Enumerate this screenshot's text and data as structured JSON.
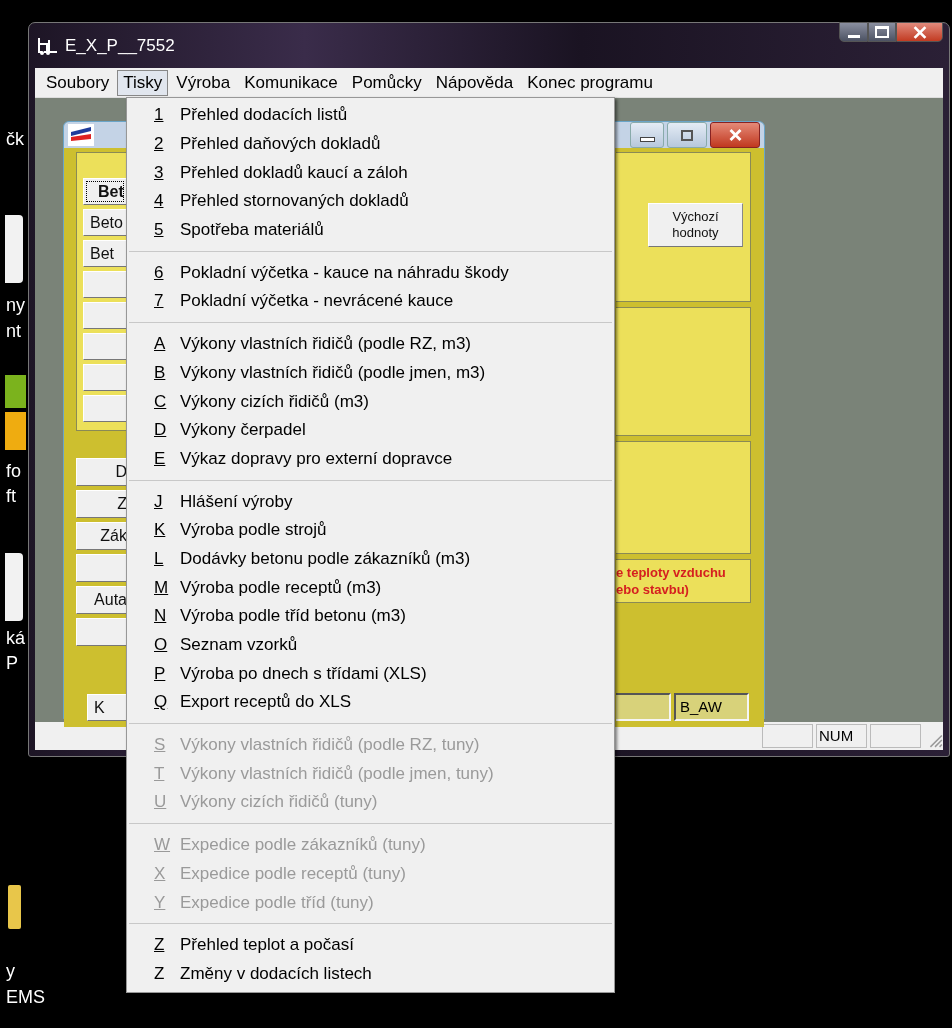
{
  "desktop_labels": [
    "čk",
    "ny",
    "nt",
    "fo",
    "ft",
    "ká",
    "P",
    "y",
    "EMS"
  ],
  "window": {
    "title": "E_X_P__7552"
  },
  "menu_bar": [
    {
      "label": "Soubory",
      "selected": false
    },
    {
      "label": "Tisky",
      "selected": true
    },
    {
      "label": "Výroba",
      "selected": false
    },
    {
      "label": "Komunikace",
      "selected": false
    },
    {
      "label": "Pomůcky",
      "selected": false
    },
    {
      "label": "Nápověda",
      "selected": false
    },
    {
      "label": "Konec programu",
      "selected": false
    }
  ],
  "child_window": {
    "frame_buttons": [
      {
        "label": "Bet",
        "focused": true
      },
      {
        "label": "Beto",
        "focused": false
      },
      {
        "label": "Bet",
        "focused": false
      },
      {
        "focused": false
      },
      {
        "focused": false
      },
      {
        "focused": false
      },
      {
        "focused": false
      },
      {
        "focused": false
      }
    ],
    "side_buttons": [
      {
        "kind": "labeled",
        "label": "D"
      },
      {
        "kind": "labeled",
        "label": "Z"
      },
      {
        "kind": "labeled",
        "label": "Zák"
      },
      {
        "kind": "blank"
      },
      {
        "kind": "labeled",
        "label": "Auta"
      },
      {
        "kind": "blank"
      }
    ],
    "bottom_button": "K",
    "defaults_button": "Výchozí hodnoty",
    "warning_lines": [
      "e teploty vzduchu",
      "ebo stavbu)"
    ],
    "status_fields": [
      {
        "kind": "blank"
      },
      {
        "kind": "labeled",
        "label": "B_AW"
      }
    ]
  },
  "status_bar": {
    "panels": [
      {
        "kind": "blank"
      },
      {
        "kind": "labeled",
        "label": "NUM"
      },
      {
        "kind": "blank"
      }
    ]
  },
  "dropdown": [
    {
      "kind": "item",
      "key": "1",
      "label": "Přehled dodacích listů",
      "disabled": false,
      "underlined": true
    },
    {
      "kind": "item",
      "key": "2",
      "label": "Přehled daňových dokladů",
      "disabled": false,
      "underlined": true
    },
    {
      "kind": "item",
      "key": "3",
      "label": "Přehled dokladů kaucí a záloh",
      "disabled": false,
      "underlined": true
    },
    {
      "kind": "item",
      "key": "4",
      "label": "Přehled stornovaných dokladů",
      "disabled": false,
      "underlined": true
    },
    {
      "kind": "item",
      "key": "5",
      "label": "Spotřeba materiálů",
      "disabled": false,
      "underlined": true
    },
    {
      "kind": "separator"
    },
    {
      "kind": "item",
      "key": "6",
      "label": "Pokladní výčetka - kauce na náhradu škody",
      "disabled": false,
      "underlined": true
    },
    {
      "kind": "item",
      "key": "7",
      "label": "Pokladní výčetka - nevrácené kauce",
      "disabled": false,
      "underlined": true
    },
    {
      "kind": "separator"
    },
    {
      "kind": "item",
      "key": "A",
      "label": "Výkony vlastních řidičů (podle RZ, m3)",
      "disabled": false,
      "underlined": true
    },
    {
      "kind": "item",
      "key": "B",
      "label": "Výkony vlastních řidičů (podle jmen, m3)",
      "disabled": false,
      "underlined": true
    },
    {
      "kind": "item",
      "key": "C",
      "label": "Výkony cizích řidičů (m3)",
      "disabled": false,
      "underlined": true
    },
    {
      "kind": "item",
      "key": "D",
      "label": "Výkony čerpadel",
      "disabled": false,
      "underlined": true
    },
    {
      "kind": "item",
      "key": "E",
      "label": "Výkaz dopravy pro externí dopravce",
      "disabled": false,
      "underlined": true
    },
    {
      "kind": "separator"
    },
    {
      "kind": "item",
      "key": "J",
      "label": "Hlášení výroby",
      "disabled": false,
      "underlined": true
    },
    {
      "kind": "item",
      "key": "K",
      "label": "Výroba podle strojů",
      "disabled": false,
      "underlined": true
    },
    {
      "kind": "item",
      "key": "L",
      "label": "Dodávky betonu podle zákazníků (m3)",
      "disabled": false,
      "underlined": true
    },
    {
      "kind": "item",
      "key": "M",
      "label": "Výroba podle receptů (m3)",
      "disabled": false,
      "underlined": true
    },
    {
      "kind": "item",
      "key": "N",
      "label": "Výroba podle tříd betonu (m3)",
      "disabled": false,
      "underlined": true
    },
    {
      "kind": "item",
      "key": "O",
      "label": "Seznam vzorků",
      "disabled": false,
      "underlined": true
    },
    {
      "kind": "item",
      "key": "P",
      "label": "Výroba po dnech s třídami (XLS)",
      "disabled": false,
      "underlined": true
    },
    {
      "kind": "item",
      "key": "Q",
      "label": "Export receptů do XLS",
      "disabled": false,
      "underlined": true
    },
    {
      "kind": "separator"
    },
    {
      "kind": "item",
      "key": "S",
      "label": "Výkony vlastních řidičů (podle RZ, tuny)",
      "disabled": true,
      "underlined": true
    },
    {
      "kind": "item",
      "key": "T",
      "label": "Výkony vlastních řidičů (podle jmen, tuny)",
      "disabled": true,
      "underlined": true
    },
    {
      "kind": "item",
      "key": "U",
      "label": "Výkony cizích řidičů (tuny)",
      "disabled": true,
      "underlined": true
    },
    {
      "kind": "separator"
    },
    {
      "kind": "item",
      "key": "W",
      "label": "Expedice podle zákazníků (tuny)",
      "disabled": true,
      "underlined": true
    },
    {
      "kind": "item",
      "key": "X",
      "label": "Expedice podle receptů (tuny)",
      "disabled": true,
      "underlined": true
    },
    {
      "kind": "item",
      "key": "Y",
      "label": "Expedice podle tříd (tuny)",
      "disabled": true,
      "underlined": true
    },
    {
      "kind": "separator"
    },
    {
      "kind": "item",
      "key": "Z",
      "label": "Přehled teplot a počasí",
      "disabled": false,
      "underlined": true
    },
    {
      "kind": "item",
      "key": "Z",
      "label": "Změny v dodacích listech",
      "disabled": false,
      "underlined": false
    }
  ]
}
